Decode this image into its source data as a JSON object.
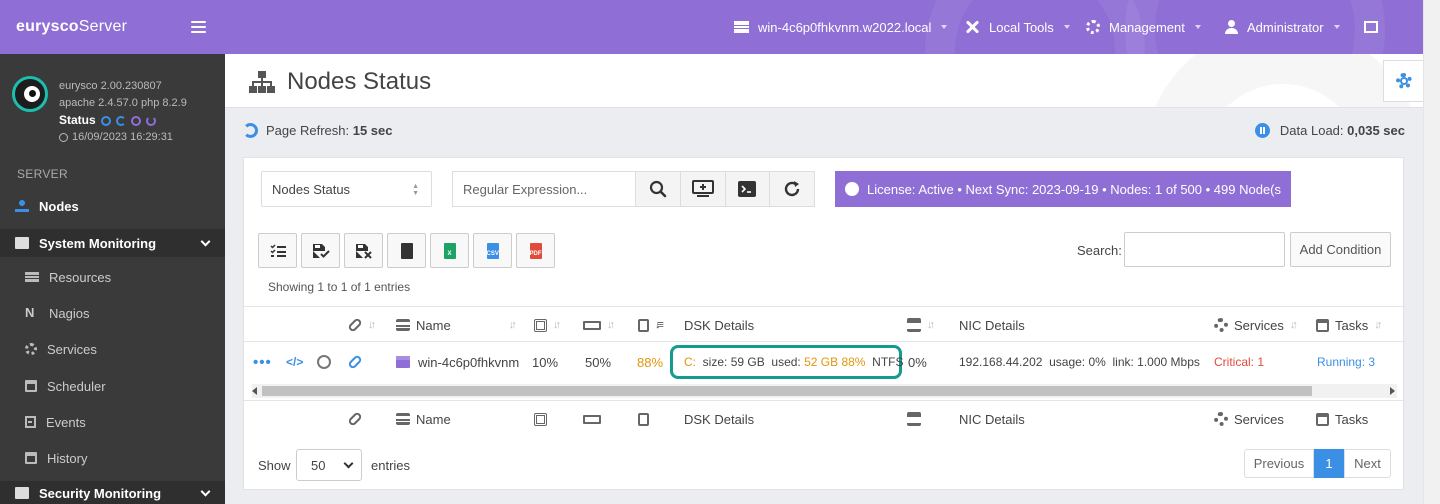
{
  "brand": {
    "prefix": "eurysco",
    "suffix": "Server"
  },
  "profile": {
    "version": "eurysco 2.00.230807",
    "stack": "apache 2.4.57.0  php 8.2.9",
    "status_label": "Status",
    "timestamp": "16/09/2023 16:29:31"
  },
  "sidebar": {
    "section": "SERVER",
    "items": [
      {
        "label": "Nodes",
        "icon": "sitemap-icon"
      },
      {
        "label": "System Monitoring",
        "icon": "monitor-icon"
      },
      {
        "label": "Resources",
        "icon": "server-icon"
      },
      {
        "label": "Nagios",
        "icon": "nagios-icon"
      },
      {
        "label": "Services",
        "icon": "gear-icon"
      },
      {
        "label": "Scheduler",
        "icon": "calendar-icon"
      },
      {
        "label": "Events",
        "icon": "list-icon"
      },
      {
        "label": "History",
        "icon": "calendar-icon"
      },
      {
        "label": "Security Monitoring",
        "icon": "monitor-icon"
      }
    ]
  },
  "topbar": {
    "host": "win-4c6p0fhkvnm.w2022.local",
    "local_tools": "Local Tools",
    "management": "Management",
    "user": "Administrator"
  },
  "page": {
    "title": "Nodes Status"
  },
  "info": {
    "refresh_label": "Page Refresh:",
    "refresh_value": "15 sec",
    "dataload_label": "Data Load:",
    "dataload_value": "0,035 sec"
  },
  "filters": {
    "select_value": "Nodes Status",
    "regex_placeholder": "Regular Expression...",
    "license": "License: Active • Next Sync: 2023-09-19 • Nodes: 1 of 500 • 499 Node(s"
  },
  "table": {
    "search_label": "Search:",
    "add_condition": "Add Condition",
    "showing": "Showing 1 to 1 of 1 entries",
    "headers": {
      "name": "Name",
      "dsk": "DSK Details",
      "nic": "NIC Details",
      "services": "Services",
      "tasks": "Tasks"
    },
    "row": {
      "name": "win-4c6p0fhkvnm",
      "cpu": "10%",
      "ram": "50%",
      "disk_pct": "88%",
      "dsk_drive": "C:",
      "dsk_size_label": "size:",
      "dsk_size": "59 GB",
      "dsk_used_label": "used:",
      "dsk_used": "52 GB 88%",
      "dsk_fs": "NTFS",
      "net_pct": "0%",
      "nic_ip": "192.168.44.202",
      "nic_usage": "usage: 0%",
      "nic_link": "link: 1.000 Mbps",
      "services": "Critical: 1",
      "tasks": "Running: 3"
    }
  },
  "footer": {
    "show_label": "Show",
    "page_size": "50",
    "entries_label": "entries",
    "previous": "Previous",
    "current_page": "1",
    "next": "Next"
  },
  "colors": {
    "accent": "#8f6fd6",
    "primary": "#3b8fe4",
    "highlight": "#159a8f",
    "warning": "#e0960c",
    "danger": "#e04b3b"
  }
}
